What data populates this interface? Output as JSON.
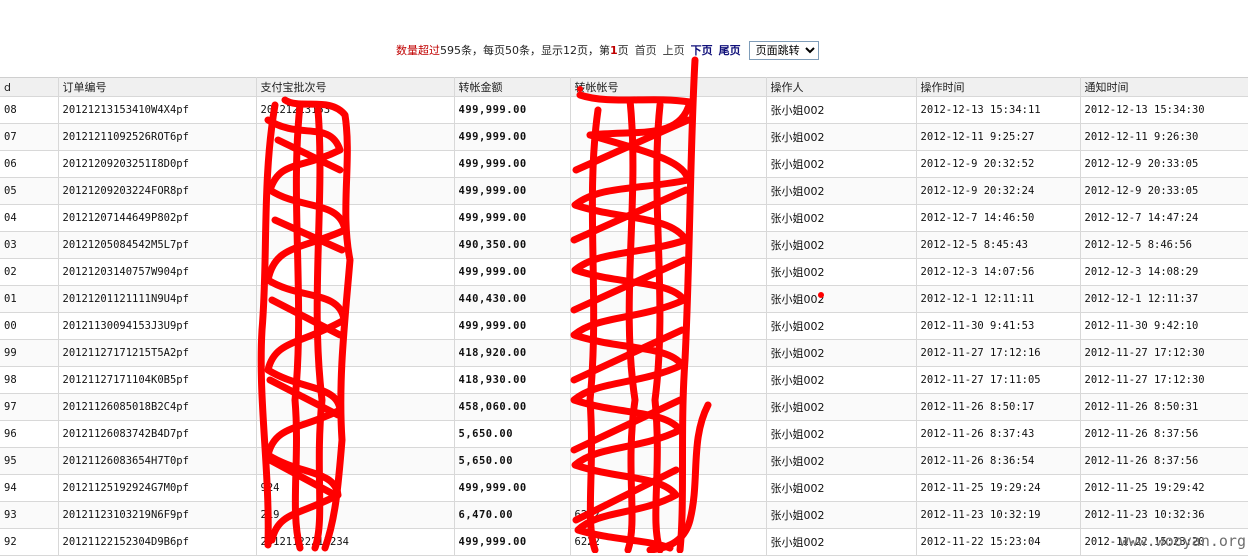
{
  "pager": {
    "label_total_prefix": "数量超过",
    "total_rest": "595条，每页50条，显示12页，第",
    "current_page": "1",
    "page_suffix": "页",
    "first": "首页",
    "prev": "上页",
    "next": "下页",
    "last": "尾页",
    "jump_select": "页面跳转"
  },
  "table": {
    "headers": [
      "d",
      "订单编号",
      "支付宝批次号",
      "转帐金额",
      "转帐帐号",
      "操作人",
      "操作时间",
      "通知时间"
    ],
    "rows": [
      {
        "id": "08",
        "order": "20121213153410W4X4pf",
        "batch": "20121213153",
        "amount": "499,999.00",
        "account": "",
        "operator": "张小姐002",
        "op_time": "2012-12-13 15:34:11",
        "notify_time": "2012-12-13 15:34:30"
      },
      {
        "id": "07",
        "order": "20121211092526ROT6pf",
        "batch": "",
        "amount": "499,999.00",
        "account": "",
        "operator": "张小姐002",
        "op_time": "2012-12-11 9:25:27",
        "notify_time": "2012-12-11 9:26:30"
      },
      {
        "id": "06",
        "order": "20121209203251I8D0pf",
        "batch": "",
        "amount": "499,999.00",
        "account": "",
        "operator": "张小姐002",
        "op_time": "2012-12-9 20:32:52",
        "notify_time": "2012-12-9 20:33:05"
      },
      {
        "id": "05",
        "order": "20121209203224FOR8pf",
        "batch": "",
        "amount": "499,999.00",
        "account": "",
        "operator": "张小姐002",
        "op_time": "2012-12-9 20:32:24",
        "notify_time": "2012-12-9 20:33:05"
      },
      {
        "id": "04",
        "order": "20121207144649P802pf",
        "batch": "",
        "amount": "499,999.00",
        "account": "",
        "operator": "张小姐002",
        "op_time": "2012-12-7 14:46:50",
        "notify_time": "2012-12-7 14:47:24"
      },
      {
        "id": "03",
        "order": "20121205084542M5L7pf",
        "batch": "",
        "amount": "490,350.00",
        "account": "",
        "operator": "张小姐002",
        "op_time": "2012-12-5 8:45:43",
        "notify_time": "2012-12-5 8:46:56"
      },
      {
        "id": "02",
        "order": "20121203140757W904pf",
        "batch": "",
        "amount": "499,999.00",
        "account": "",
        "operator": "张小姐002",
        "op_time": "2012-12-3 14:07:56",
        "notify_time": "2012-12-3 14:08:29"
      },
      {
        "id": "01",
        "order": "20121201121111N9U4pf",
        "batch": "",
        "amount": "440,430.00",
        "account": "",
        "operator": "张小姐002",
        "op_time": "2012-12-1 12:11:11",
        "notify_time": "2012-12-1 12:11:37"
      },
      {
        "id": "00",
        "order": "20121130094153J3U9pf",
        "batch": "",
        "amount": "499,999.00",
        "account": "",
        "operator": "张小姐002",
        "op_time": "2012-11-30 9:41:53",
        "notify_time": "2012-11-30 9:42:10"
      },
      {
        "id": "99",
        "order": "20121127171215T5A2pf",
        "batch": "",
        "amount": "418,920.00",
        "account": "",
        "operator": "张小姐002",
        "op_time": "2012-11-27 17:12:16",
        "notify_time": "2012-11-27 17:12:30"
      },
      {
        "id": "98",
        "order": "20121127171104K0B5pf",
        "batch": "",
        "amount": "418,930.00",
        "account": "",
        "operator": "张小姐002",
        "op_time": "2012-11-27 17:11:05",
        "notify_time": "2012-11-27 17:12:30"
      },
      {
        "id": "97",
        "order": "20121126085018B2C4pf",
        "batch": "",
        "amount": "458,060.00",
        "account": "",
        "operator": "张小姐002",
        "op_time": "2012-11-26 8:50:17",
        "notify_time": "2012-11-26 8:50:31"
      },
      {
        "id": "96",
        "order": "20121126083742B4D7pf",
        "batch": "",
        "amount": "5,650.00",
        "account": "",
        "operator": "张小姐002",
        "op_time": "2012-11-26 8:37:43",
        "notify_time": "2012-11-26 8:37:56"
      },
      {
        "id": "95",
        "order": "20121126083654H7T0pf",
        "batch": "",
        "amount": "5,650.00",
        "account": "",
        "operator": "张小姐002",
        "op_time": "2012-11-26 8:36:54",
        "notify_time": "2012-11-26 8:37:56"
      },
      {
        "id": "94",
        "order": "20121125192924G7M0pf",
        "batch": "924",
        "amount": "499,999.00",
        "account": "",
        "operator": "张小姐002",
        "op_time": "2012-11-25 19:29:24",
        "notify_time": "2012-11-25 19:29:42"
      },
      {
        "id": "93",
        "order": "20121123103219N6F9pf",
        "batch": "219",
        "amount": "6,470.00",
        "account": "6222",
        "operator": "张小姐002",
        "op_time": "2012-11-23 10:32:19",
        "notify_time": "2012-11-23 10:32:36"
      },
      {
        "id": "92",
        "order": "20121122152304D9B6pf",
        "batch": "20121122215234",
        "amount": "499,999.00",
        "account": "6222",
        "operator": "张小姐002",
        "op_time": "2012-11-22 15:23:04",
        "notify_time": "2012-11-22 15:23:20"
      }
    ]
  },
  "watermark": "www.wooyan.org",
  "colors": {
    "scribble": "#ff0000",
    "header_bg": "#f0f0f0",
    "highlight": "#c00000",
    "link_bold": "#10107a"
  }
}
